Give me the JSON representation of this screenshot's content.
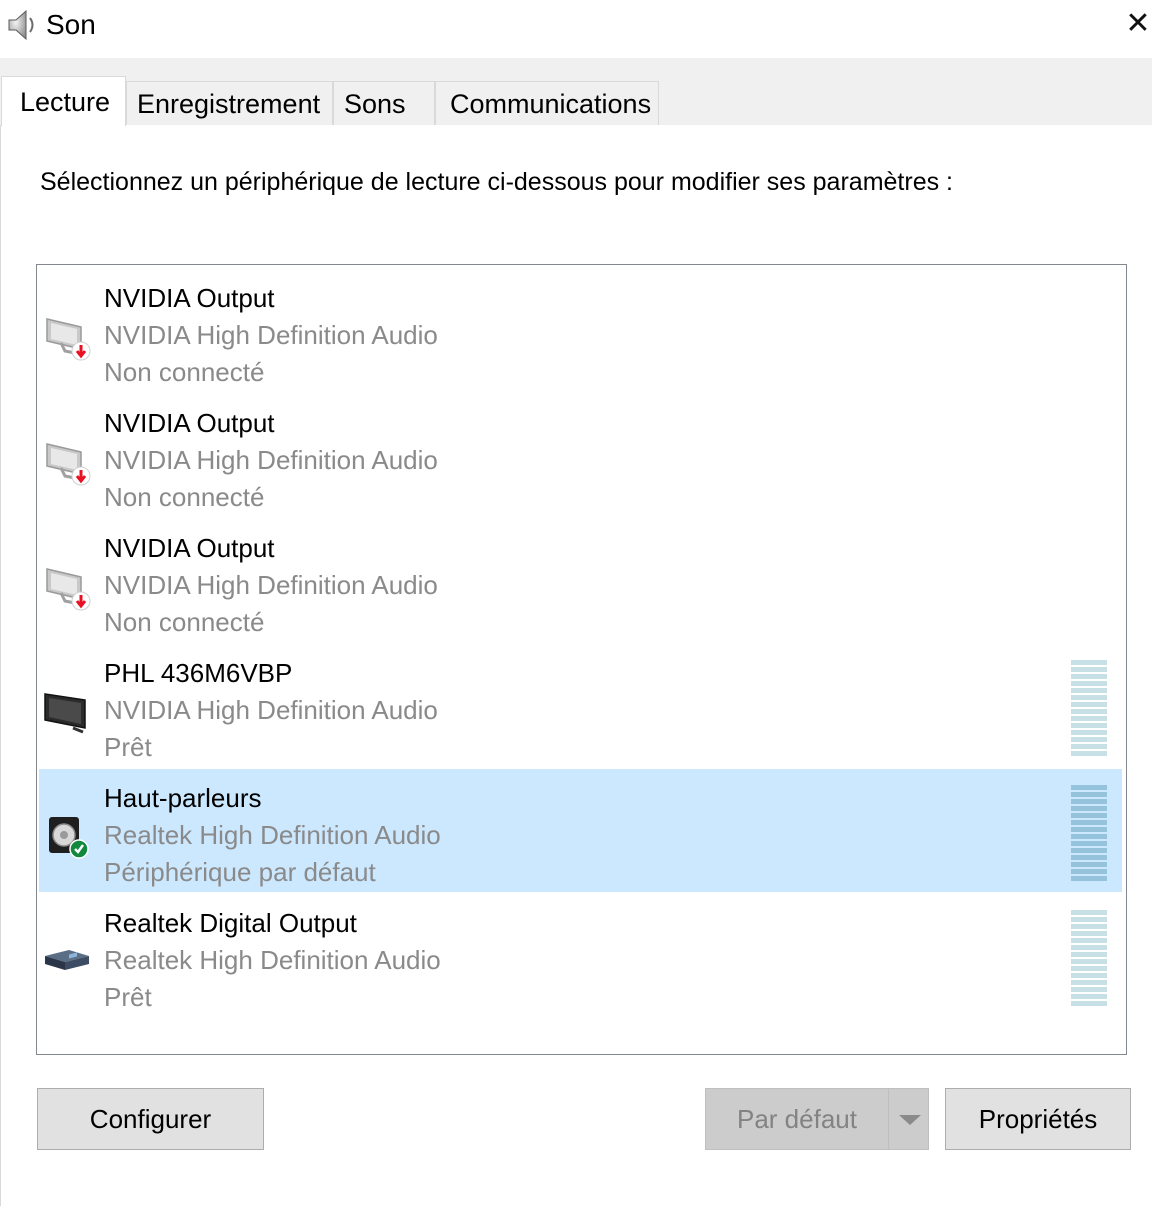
{
  "window": {
    "title": "Son",
    "icon": "speaker-icon",
    "close_icon": "close-icon"
  },
  "tabs": [
    {
      "label": "Lecture",
      "active": true
    },
    {
      "label": "Enregistrement",
      "active": false
    },
    {
      "label": "Sons",
      "active": false
    },
    {
      "label": "Communications",
      "active": false
    }
  ],
  "instruction": "Sélectionnez un périphérique de lecture ci-dessous pour modifier ses paramètres :",
  "devices": [
    {
      "name": "NVIDIA Output",
      "driver": "NVIDIA High Definition Audio",
      "status": "Non connecté",
      "icon": "monitor-disconnected-icon",
      "selected": false,
      "meter": false
    },
    {
      "name": "NVIDIA Output",
      "driver": "NVIDIA High Definition Audio",
      "status": "Non connecté",
      "icon": "monitor-disconnected-icon",
      "selected": false,
      "meter": false
    },
    {
      "name": "NVIDIA Output",
      "driver": "NVIDIA High Definition Audio",
      "status": "Non connecté",
      "icon": "monitor-disconnected-icon",
      "selected": false,
      "meter": false
    },
    {
      "name": "PHL 436M6VBP",
      "driver": "NVIDIA High Definition Audio",
      "status": "Prêt",
      "icon": "monitor-icon",
      "selected": false,
      "meter": true
    },
    {
      "name": "Haut-parleurs",
      "driver": "Realtek High Definition Audio",
      "status": "Périphérique par défaut",
      "icon": "speaker-default-icon",
      "selected": true,
      "meter": true
    },
    {
      "name": "Realtek Digital Output",
      "driver": "Realtek High Definition Audio",
      "status": "Prêt",
      "icon": "digital-output-icon",
      "selected": false,
      "meter": true
    }
  ],
  "buttons": {
    "configure": "Configurer",
    "set_default": "Par défaut",
    "set_default_enabled": false,
    "properties": "Propriétés"
  },
  "colors": {
    "selection": "#cce8ff",
    "disconnected_arrow": "#e81123",
    "default_check": "#10893e",
    "meter_idle": "#c7e0e6",
    "meter_selected": "#96c3dc"
  }
}
